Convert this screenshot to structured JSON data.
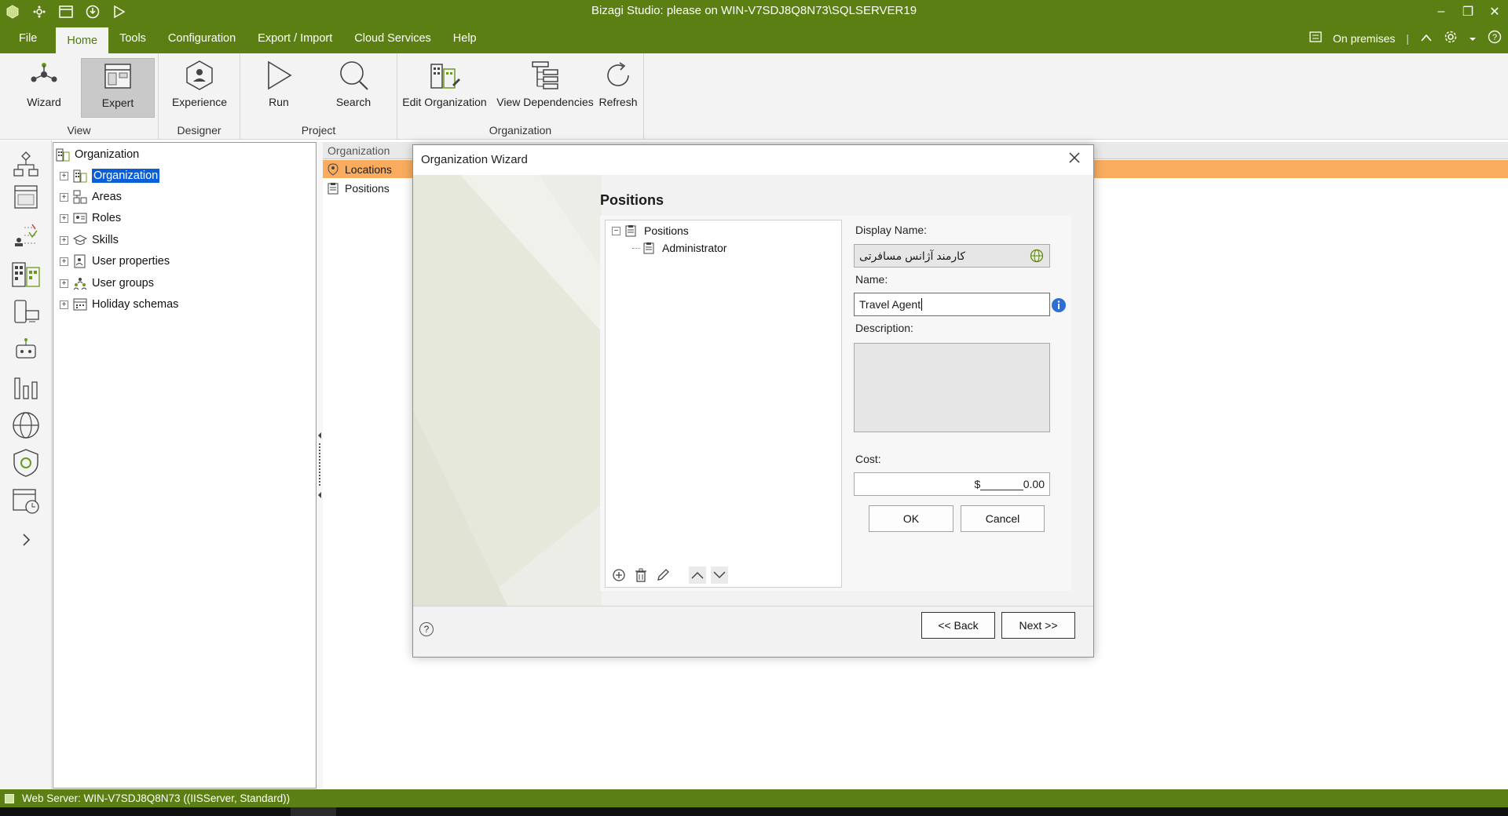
{
  "window": {
    "title": "Bizagi Studio: please  on WIN-V7SDJ8Q8N73\\SQLSERVER19",
    "minimize": "–",
    "restore": "❐",
    "close": "✕"
  },
  "menu": {
    "items": [
      "File",
      "Home",
      "Tools",
      "Configuration",
      "Export / Import",
      "Cloud Services",
      "Help"
    ],
    "active": "Home",
    "right_status": "On premises"
  },
  "ribbon": {
    "groups": [
      {
        "label": "View",
        "buttons": [
          "Wizard",
          "Expert"
        ]
      },
      {
        "label": "Designer",
        "buttons": [
          "Experience"
        ]
      },
      {
        "label": "Project",
        "buttons": [
          "Run",
          "Search"
        ]
      },
      {
        "label": "Organization",
        "buttons": [
          "Edit Organization",
          "View Dependencies",
          "Refresh"
        ]
      }
    ]
  },
  "tree": {
    "root": "Organization",
    "items": [
      "Organization",
      "Areas",
      "Roles",
      "Skills",
      "User properties",
      "User groups",
      "Holiday schemas"
    ],
    "selected": "Organization"
  },
  "content": {
    "header": "Organization",
    "rows": [
      "Locations",
      "Positions"
    ]
  },
  "dialog": {
    "title": "Organization Wizard",
    "heading": "Positions",
    "list": {
      "root": "Positions",
      "children": [
        "Administrator"
      ]
    },
    "form": {
      "display_name_label": "Display Name:",
      "display_name_value": "کارمند آژانس مسافرتی",
      "name_label": "Name:",
      "name_value": "Travel Agent",
      "description_label": "Description:",
      "description_value": "",
      "cost_label": "Cost:",
      "cost_value": "$_______0.00",
      "ok_label": "OK",
      "cancel_label": "Cancel"
    },
    "footer": {
      "back_label": "<< Back",
      "next_label": "Next >>",
      "help": "?"
    }
  },
  "statusbar": {
    "text": "Web Server: WIN-V7SDJ8Q8N73 ((IISServer, Standard))"
  },
  "colors": {
    "brand_green": "#5b7f12",
    "selection_blue": "#0a5fd6",
    "highlight_orange": "#f9ac5d"
  }
}
